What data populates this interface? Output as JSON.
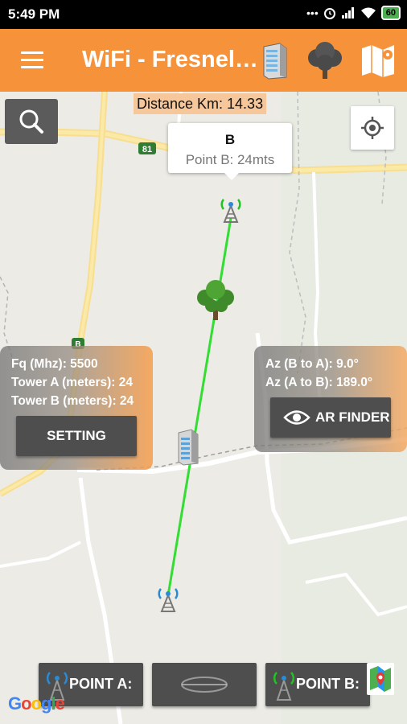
{
  "status_bar": {
    "time": "5:49 PM",
    "icons": [
      "dots-icon",
      "alarm-icon",
      "signal-icon",
      "wifi-icon"
    ],
    "battery": "60"
  },
  "app_bar": {
    "title": "WiFi - Fresnel…",
    "actions": [
      "building-icon",
      "tree-icon",
      "map-icon"
    ],
    "color": "#f6923a"
  },
  "map": {
    "distance_label": "Distance Km: 14.33",
    "route_shield": "81",
    "route_shield_small": "B",
    "marker_b_callout": {
      "title": "B",
      "subtitle": "Point B: 24mts"
    },
    "link_line_color": "#33dd33",
    "obstacles": [
      "tree-icon",
      "building-icon"
    ],
    "attribution": "Google"
  },
  "left_panel": {
    "lines": [
      "Fq (Mhz): 5500",
      "Tower A (meters): 24",
      "Tower B (meters): 24"
    ],
    "button": "SETTING"
  },
  "right_panel": {
    "lines": [
      "Az (B to A): 9.0°",
      "Az (A to B): 189.0°"
    ],
    "button": "AR FINDER"
  },
  "bottom_bar": {
    "point_a": "POINT A:",
    "point_b": "POINT B:"
  }
}
